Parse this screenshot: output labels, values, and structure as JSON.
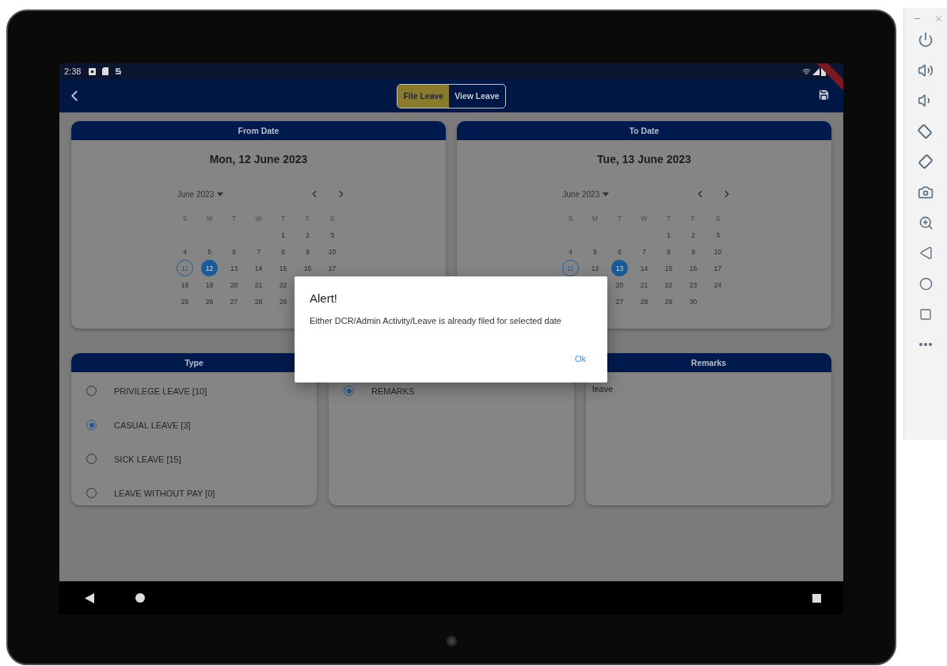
{
  "status_bar": {
    "time": "2:38"
  },
  "app_bar": {
    "tabs": [
      {
        "label": "File Leave",
        "selected": true
      },
      {
        "label": "View Leave",
        "selected": false
      }
    ]
  },
  "calendars": [
    {
      "heading": "From Date",
      "date_label": "Mon, 12 June 2023",
      "month_label": "June 2023",
      "weekdays": [
        "S",
        "M",
        "T",
        "W",
        "T",
        "F",
        "S"
      ],
      "weeks": [
        [
          "1",
          "2",
          "3"
        ],
        [
          "4",
          "5",
          "6",
          "7",
          "8",
          "9",
          "10"
        ],
        [
          {
            "label": "11",
            "today": true,
            "selected": false
          },
          {
            "label": "12",
            "today": false,
            "selected": true
          },
          "13",
          "14",
          "15",
          "16",
          "17"
        ],
        [
          "18",
          "19",
          "20",
          "21",
          "22"
        ],
        [
          "25",
          "26",
          "27",
          "28",
          "29"
        ]
      ]
    },
    {
      "heading": "To Date",
      "date_label": "Tue, 13 June 2023",
      "month_label": "June 2023",
      "weekdays": [
        "S",
        "M",
        "T",
        "W",
        "T",
        "F",
        "S"
      ],
      "weeks": [
        [
          "1",
          "2",
          "3"
        ],
        [
          "4",
          "5",
          "6",
          "7",
          "8",
          "9",
          "10"
        ],
        [
          {
            "label": "11",
            "today": true,
            "selected": false
          },
          "12",
          {
            "label": "13",
            "today": false,
            "selected": true
          },
          "14",
          "15",
          "16",
          "17"
        ],
        [
          "20",
          "21",
          "22",
          "23",
          "24"
        ],
        [
          "27",
          "28",
          "29",
          "30"
        ]
      ]
    }
  ],
  "type_card": {
    "heading": "Type",
    "options": [
      {
        "label": "PRIVILEGE LEAVE [10]",
        "selected": false
      },
      {
        "label": "CASUAL LEAVE [3]",
        "selected": true
      },
      {
        "label": "SICK LEAVE [15]",
        "selected": false
      },
      {
        "label": "LEAVE WITHOUT PAY [0]",
        "selected": false
      }
    ]
  },
  "middle_card": {
    "options": [
      {
        "label": "REMARKS",
        "selected": true
      }
    ]
  },
  "remarks_card": {
    "heading": "Remarks",
    "value": "leave"
  },
  "dialog": {
    "title": "Alert!",
    "message": "Either DCR/Admin Activity/Leave is already filed for selected date",
    "button": "Ok"
  }
}
